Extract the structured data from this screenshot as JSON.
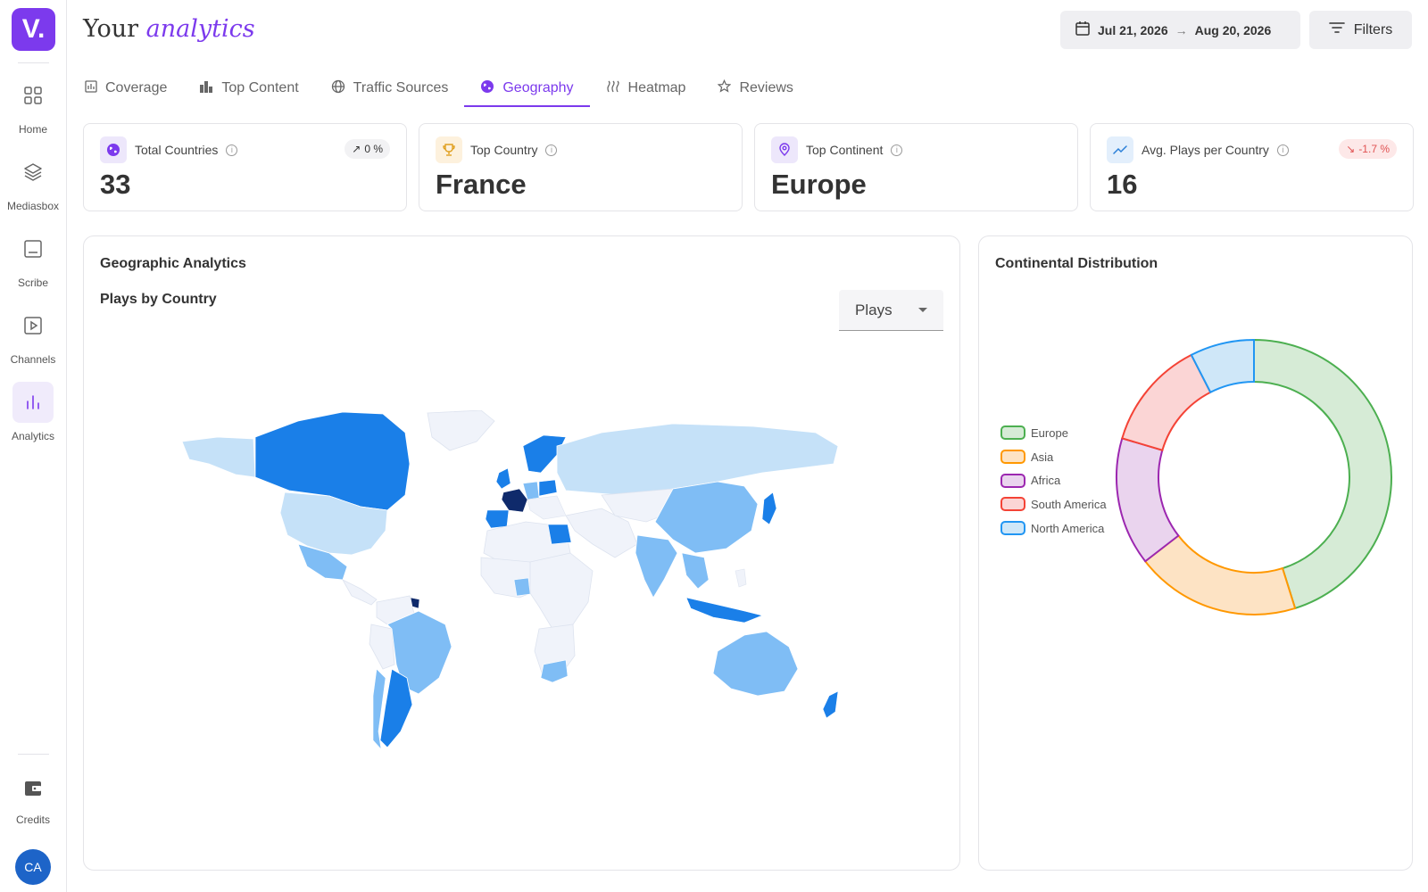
{
  "app": {
    "logo_text": "V."
  },
  "sidebar": {
    "items": [
      {
        "label": "Home",
        "icon": "grid-icon"
      },
      {
        "label": "Mediasbox",
        "icon": "layers-icon"
      },
      {
        "label": "Scribe",
        "icon": "document-icon"
      },
      {
        "label": "Channels",
        "icon": "play-icon"
      },
      {
        "label": "Analytics",
        "icon": "bar-chart-icon",
        "active": true
      }
    ],
    "credits_label": "Credits",
    "avatar_initials": "CA"
  },
  "header": {
    "title_plain": "Your",
    "title_accent": "analytics",
    "date_start": "Jul 21, 2026",
    "date_end": "Aug 20, 2026",
    "filters_label": "Filters"
  },
  "tabs": [
    {
      "label": "Coverage",
      "icon": "coverage-icon"
    },
    {
      "label": "Top Content",
      "icon": "bar-icon"
    },
    {
      "label": "Traffic Sources",
      "icon": "globe-icon"
    },
    {
      "label": "Geography",
      "icon": "earth-icon",
      "active": true
    },
    {
      "label": "Heatmap",
      "icon": "heat-icon"
    },
    {
      "label": "Reviews",
      "icon": "star-icon"
    }
  ],
  "stats": {
    "total_countries": {
      "label": "Total Countries",
      "value": "33",
      "badge": "0 %"
    },
    "top_country": {
      "label": "Top Country",
      "value": "France"
    },
    "top_continent": {
      "label": "Top Continent",
      "value": "Europe"
    },
    "avg_plays": {
      "label": "Avg. Plays per Country",
      "value": "16",
      "badge": "-1.7 %"
    }
  },
  "geo": {
    "title": "Geographic Analytics",
    "subtitle": "Plays by Country",
    "metric_select": "Plays"
  },
  "continental": {
    "title": "Continental Distribution"
  },
  "colors": {
    "accent": "#7c3aed",
    "map_dark": "#0f2a6b",
    "map_strong": "#1a7fe8",
    "map_mid": "#7fbdf5",
    "map_light": "#c5e1f8",
    "map_none": "#f0f3fa"
  },
  "chart_data": {
    "type": "pie",
    "donut": true,
    "categories": [
      "Europe",
      "Asia",
      "Africa",
      "South America",
      "North America"
    ],
    "values": [
      42,
      18,
      14,
      12,
      7
    ],
    "colors": {
      "fill": [
        "#d6ebd6",
        "#fde3c4",
        "#ead4ee",
        "#fbd5d5",
        "#cfe7f8"
      ],
      "stroke": [
        "#4caf50",
        "#ff9800",
        "#9c27b0",
        "#f44336",
        "#2196f3"
      ]
    },
    "legend_position": "left"
  }
}
